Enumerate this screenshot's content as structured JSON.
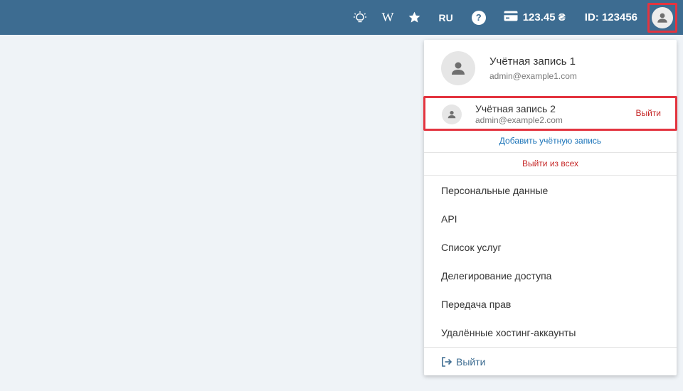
{
  "topbar": {
    "bg_color": "#3d6c91",
    "icons": {
      "bulb": "lightbulb-icon",
      "wiki": "wikipedia-icon",
      "star": "star-icon",
      "help": "help-icon",
      "card": "credit-card-icon",
      "user": "user-icon"
    },
    "wiki_label": "W",
    "language": "RU",
    "help_label": "?",
    "balance": "123.45 ₴",
    "account_id": "ID: 123456"
  },
  "dropdown": {
    "primary_account": {
      "name": "Учётная запись 1",
      "email": "admin@example1.com"
    },
    "secondary_account": {
      "name": "Учётная запись 2",
      "email": "admin@example2.com",
      "logout_label": "Выйти"
    },
    "add_account_label": "Добавить учётную запись",
    "logout_all_label": "Выйти из всех",
    "menu_items": [
      "Персональные данные",
      "API",
      "Список услуг",
      "Делегирование доступа",
      "Передача прав",
      "Удалённые хостинг-аккаунты"
    ],
    "footer_logout_label": "Выйти",
    "highlight_color": "#e3343f",
    "link_color": "#1a73b8",
    "danger_color": "#c62828"
  }
}
